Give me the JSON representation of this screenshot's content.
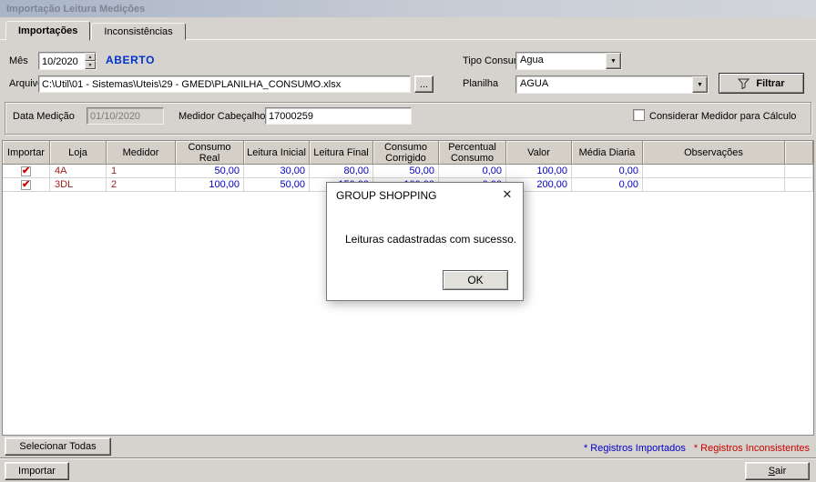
{
  "window": {
    "title": "Importação Leitura Medições"
  },
  "tabs": {
    "importacoes": "Importações",
    "inconsistencias": "Inconsistências"
  },
  "form": {
    "mes_label": "Mês",
    "mes_value": "10/2020",
    "status_value": "ABERTO",
    "tipo_consumo_label": "Tipo Consumo",
    "tipo_consumo_value": "Agua",
    "arquivo_label": "Arquivo",
    "arquivo_value": "C:\\Util\\01 - Sistemas\\Uteis\\29 - GMED\\PLANILHA_CONSUMO.xlsx",
    "browse_label": "...",
    "planilha_label": "Planilha",
    "planilha_value": "AGUA",
    "filtrar_label": "Filtrar"
  },
  "medicao": {
    "data_medicao_label": "Data Medição",
    "data_medicao_value": "01/10/2020",
    "medidor_cabecalho_label": "Medidor Cabeçalho",
    "medidor_cabecalho_value": "17000259",
    "considerar_label": "Considerar Medidor para Cálculo"
  },
  "grid": {
    "headers": {
      "importar": "Importar",
      "loja": "Loja",
      "medidor": "Medidor",
      "consumo_real": "Consumo Real",
      "leitura_inicial": "Leitura Inicial",
      "leitura_final": "Leitura Final",
      "consumo_corrigido": "Consumo Corrigido",
      "percentual_consumo": "Percentual Consumo",
      "valor": "Valor",
      "media_diaria": "Média Diaria",
      "observacoes": "Observações"
    },
    "rows": [
      {
        "importar": true,
        "loja": "4A",
        "medidor": "1",
        "consumo_real": "50,00",
        "leitura_inicial": "30,00",
        "leitura_final": "80,00",
        "consumo_corrigido": "50,00",
        "percentual_consumo": "0,00",
        "valor": "100,00",
        "media_diaria": "0,00",
        "observacoes": ""
      },
      {
        "importar": true,
        "loja": "3DL",
        "medidor": "2",
        "consumo_real": "100,00",
        "leitura_inicial": "50,00",
        "leitura_final": "150,00",
        "consumo_corrigido": "100,00",
        "percentual_consumo": "0,00",
        "valor": "200,00",
        "media_diaria": "0,00",
        "observacoes": ""
      }
    ]
  },
  "dialog": {
    "title": "GROUP SHOPPING",
    "message": "Leituras cadastradas com sucesso.",
    "ok_label": "OK"
  },
  "footer": {
    "selecionar_todas_label": "Selecionar Todas",
    "legend_importados": "* Registros Importados",
    "legend_inconsistentes": "* Registros Inconsistentes",
    "importar_label": "Importar",
    "sair_label": "Sair"
  },
  "icons": {
    "check": "✔",
    "dropdown_arrow": "▼",
    "spin_up": "▲",
    "spin_down": "▼",
    "close": "✕"
  },
  "colors": {
    "status_open": "#0033CC",
    "grid_number": "#0000C8",
    "grid_loja": "#9C1C1C",
    "legend_imported": "#0000CC",
    "legend_inconsistent": "#CC0000"
  }
}
